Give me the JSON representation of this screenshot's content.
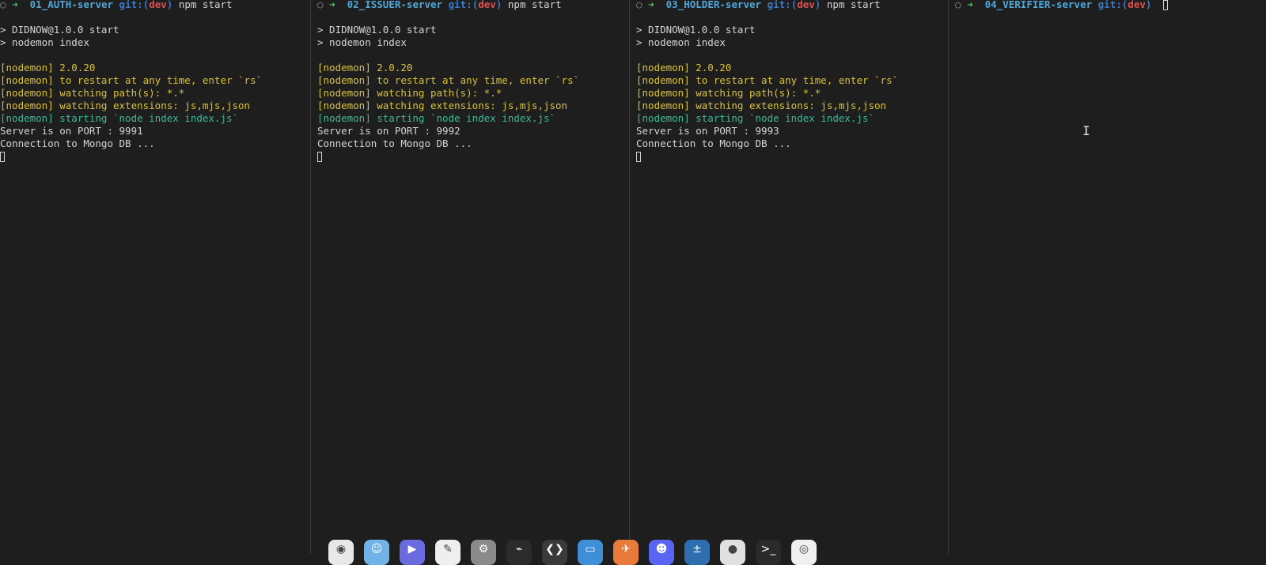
{
  "panes": [
    {
      "prompt": {
        "dot": "○",
        "arrow": "➜",
        "dir": "01_AUTH-server",
        "git": "git:(",
        "branch": "dev",
        "git_close": ")",
        "command": "npm start"
      },
      "output": [
        {
          "text": "> DIDNOW@1.0.0 start",
          "style": "plain"
        },
        {
          "text": "> nodemon index",
          "style": "plain"
        },
        {
          "text": "",
          "style": "blank"
        },
        {
          "text": "[nodemon] 2.0.20",
          "style": "yellow"
        },
        {
          "text": "[nodemon] to restart at any time, enter `rs`",
          "style": "yellow"
        },
        {
          "text": "[nodemon] watching path(s): *.*",
          "style": "yellow"
        },
        {
          "text": "[nodemon] watching extensions: js,mjs,json",
          "style": "yellow"
        },
        {
          "text": "[nodemon] starting `node index index.js`",
          "style": "green"
        },
        {
          "text": "Server is on PORT : 9991",
          "style": "plain"
        },
        {
          "text": "Connection to Mongo DB ...",
          "style": "plain"
        }
      ]
    },
    {
      "prompt": {
        "dot": "○",
        "arrow": "➜",
        "dir": "02_ISSUER-server",
        "git": "git:(",
        "branch": "dev",
        "git_close": ")",
        "command": "npm start"
      },
      "output": [
        {
          "text": "> DIDNOW@1.0.0 start",
          "style": "plain"
        },
        {
          "text": "> nodemon index",
          "style": "plain"
        },
        {
          "text": "",
          "style": "blank"
        },
        {
          "text": "[nodemon] 2.0.20",
          "style": "yellow"
        },
        {
          "text": "[nodemon] to restart at any time, enter `rs`",
          "style": "yellow"
        },
        {
          "text": "[nodemon] watching path(s): *.*",
          "style": "yellow"
        },
        {
          "text": "[nodemon] watching extensions: js,mjs,json",
          "style": "yellow"
        },
        {
          "text": "[nodemon] starting `node index index.js`",
          "style": "green"
        },
        {
          "text": "Server is on PORT : 9992",
          "style": "plain"
        },
        {
          "text": "Connection to Mongo DB ...",
          "style": "plain"
        }
      ]
    },
    {
      "prompt": {
        "dot": "○",
        "arrow": "➜",
        "dir": "03_HOLDER-server",
        "git": "git:(",
        "branch": "dev",
        "git_close": ")",
        "command": "npm start"
      },
      "output": [
        {
          "text": "> DIDNOW@1.0.0 start",
          "style": "plain"
        },
        {
          "text": "> nodemon index",
          "style": "plain"
        },
        {
          "text": "",
          "style": "blank"
        },
        {
          "text": "[nodemon] 2.0.20",
          "style": "yellow"
        },
        {
          "text": "[nodemon] to restart at any time, enter `rs`",
          "style": "yellow"
        },
        {
          "text": "[nodemon] watching path(s): *.*",
          "style": "yellow"
        },
        {
          "text": "[nodemon] watching extensions: js,mjs,json",
          "style": "yellow"
        },
        {
          "text": "[nodemon] starting `node index index.js`",
          "style": "green"
        },
        {
          "text": "Server is on PORT : 9993",
          "style": "plain"
        },
        {
          "text": "Connection to Mongo DB ...",
          "style": "plain"
        }
      ]
    },
    {
      "prompt": {
        "dot": "○",
        "arrow": "➜",
        "dir": "04_VERIFIER-server",
        "git": "git:(",
        "branch": "dev",
        "git_close": ")",
        "command": ""
      },
      "output": []
    }
  ],
  "dock": {
    "icons": [
      {
        "name": "chrome-icon",
        "color": "#e8e8e8",
        "glyph": "◉"
      },
      {
        "name": "finder-icon",
        "color": "#6fb3e8",
        "glyph": "☺"
      },
      {
        "name": "zoom-icon",
        "color": "#6b6be0",
        "glyph": "▶"
      },
      {
        "name": "textedit-icon",
        "color": "#efefef",
        "glyph": "✎"
      },
      {
        "name": "system-preferences-icon",
        "color": "#8a8a8a",
        "glyph": "⚙"
      },
      {
        "name": "activity-monitor-icon",
        "color": "#2b2b2b",
        "glyph": "⌁"
      },
      {
        "name": "vscode-icon",
        "color": "#3a3a3a",
        "glyph": "❮❯"
      },
      {
        "name": "browser-window-icon",
        "color": "#3f8fd8",
        "glyph": "▭"
      },
      {
        "name": "postman-icon",
        "color": "#e87a3a",
        "glyph": "✈"
      },
      {
        "name": "discord-icon",
        "color": "#5865f2",
        "glyph": "☻"
      },
      {
        "name": "calculator-icon",
        "color": "#2d6fae",
        "glyph": "±"
      },
      {
        "name": "github-desktop-icon",
        "color": "#e0e0e0",
        "glyph": "●"
      },
      {
        "name": "terminal-icon",
        "color": "#2a2a2a",
        "glyph": ">_"
      },
      {
        "name": "screenshot-icon",
        "color": "#f0f0f0",
        "glyph": "◎"
      }
    ]
  }
}
